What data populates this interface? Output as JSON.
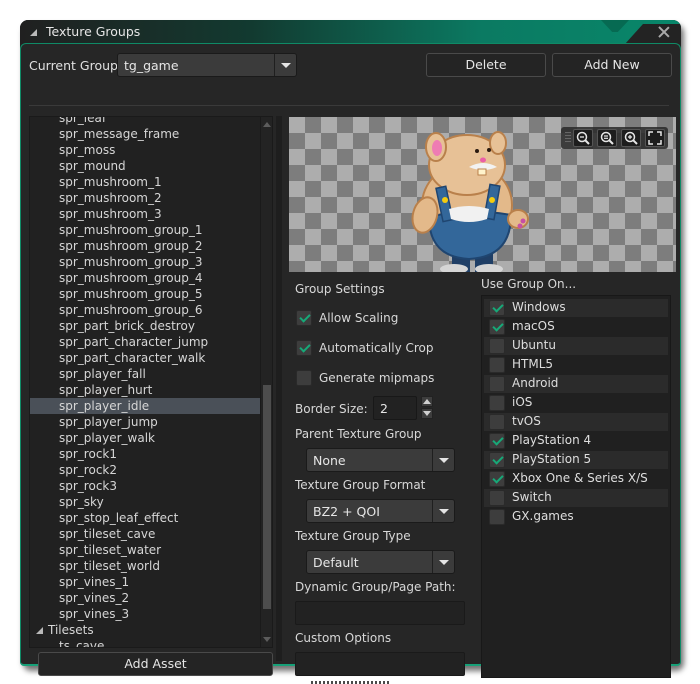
{
  "window": {
    "title": "Texture Groups"
  },
  "header": {
    "current_group_label": "Current Group:",
    "current_group_value": "tg_game",
    "delete_label": "Delete",
    "add_new_label": "Add New"
  },
  "asset_tree": {
    "items": [
      "spr_leaf",
      "spr_message_frame",
      "spr_moss",
      "spr_mound",
      "spr_mushroom_1",
      "spr_mushroom_2",
      "spr_mushroom_3",
      "spr_mushroom_group_1",
      "spr_mushroom_group_2",
      "spr_mushroom_group_3",
      "spr_mushroom_group_4",
      "spr_mushroom_group_5",
      "spr_mushroom_group_6",
      "spr_part_brick_destroy",
      "spr_part_character_jump",
      "spr_part_character_walk",
      "spr_player_fall",
      "spr_player_hurt",
      "spr_player_idle",
      "spr_player_jump",
      "spr_player_walk",
      "spr_rock1",
      "spr_rock2",
      "spr_rock3",
      "spr_sky",
      "spr_stop_leaf_effect",
      "spr_tileset_cave",
      "spr_tileset_water",
      "spr_tileset_world",
      "spr_vines_1",
      "spr_vines_2",
      "spr_vines_3"
    ],
    "selected": "spr_player_idle",
    "folder": "Tilesets",
    "folder_items": [
      "ts_cave"
    ],
    "add_asset_label": "Add Asset"
  },
  "preview": {
    "zoom_controls": [
      "zoom-out-icon",
      "zoom-reset-icon",
      "zoom-in-icon",
      "fit-screen-icon"
    ]
  },
  "settings": {
    "group_settings_label": "Group Settings",
    "allow_scaling": {
      "label": "Allow Scaling",
      "checked": true
    },
    "auto_crop": {
      "label": "Automatically Crop",
      "checked": true
    },
    "mipmaps": {
      "label": "Generate mipmaps",
      "checked": false
    },
    "border_size_label": "Border Size:",
    "border_size_value": "2",
    "parent_group_label": "Parent Texture Group",
    "parent_group_value": "None",
    "format_label": "Texture Group Format",
    "format_value": "BZ2 + QOI",
    "type_label": "Texture Group Type",
    "type_value": "Default",
    "dynamic_path_label": "Dynamic Group/Page Path:",
    "dynamic_path_value": "",
    "custom_options_label": "Custom Options",
    "custom_options_value": ""
  },
  "platforms": {
    "label": "Use Group On...",
    "items": [
      {
        "name": "Windows",
        "checked": true
      },
      {
        "name": "macOS",
        "checked": true
      },
      {
        "name": "Ubuntu",
        "checked": false
      },
      {
        "name": "HTML5",
        "checked": false
      },
      {
        "name": "Android",
        "checked": false
      },
      {
        "name": "iOS",
        "checked": false
      },
      {
        "name": "tvOS",
        "checked": false
      },
      {
        "name": "PlayStation 4",
        "checked": true
      },
      {
        "name": "PlayStation 5",
        "checked": true
      },
      {
        "name": "Xbox One & Series X/S",
        "checked": true
      },
      {
        "name": "Switch",
        "checked": false
      },
      {
        "name": "GX.games",
        "checked": false
      }
    ]
  },
  "colors": {
    "accent": "#17a978",
    "title_gradient_end": "#08876a",
    "selection": "#4a5058"
  }
}
